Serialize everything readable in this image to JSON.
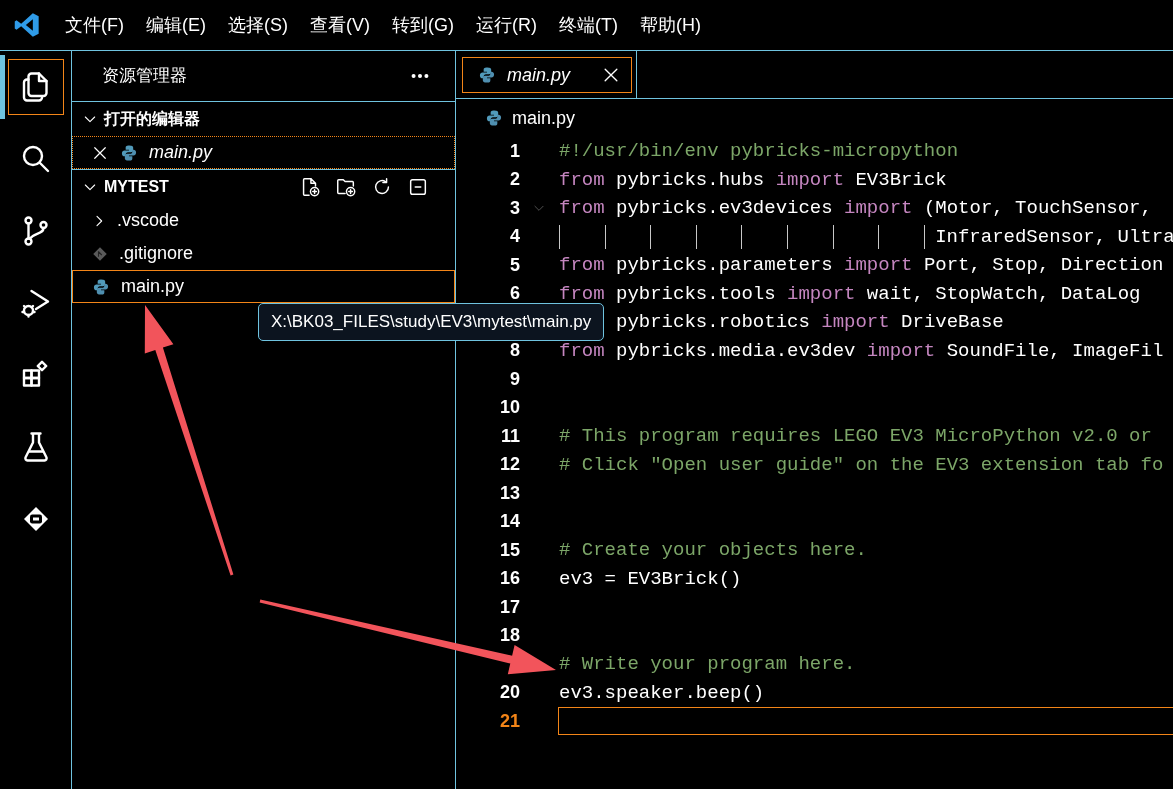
{
  "menu": [
    "文件(F)",
    "编辑(E)",
    "选择(S)",
    "查看(V)",
    "转到(G)",
    "运行(R)",
    "终端(T)",
    "帮助(H)"
  ],
  "activity_bar": [
    {
      "kind": "files",
      "selected": true
    },
    {
      "kind": "search",
      "selected": false
    },
    {
      "kind": "source-control",
      "selected": false
    },
    {
      "kind": "run-debug",
      "selected": false
    },
    {
      "kind": "extensions",
      "selected": false
    },
    {
      "kind": "testing",
      "selected": false
    },
    {
      "kind": "robot",
      "selected": false
    }
  ],
  "sidebar": {
    "title": "资源管理器",
    "open_editors": {
      "title": "打开的编辑器",
      "expanded": true,
      "items": [
        {
          "name": "main.py",
          "selected": true
        }
      ]
    },
    "folder": {
      "title": "MYTEST",
      "expanded": true,
      "items": [
        {
          "name": ".vscode",
          "kind": "folder",
          "expanded": false,
          "selected": false
        },
        {
          "name": ".gitignore",
          "kind": "git",
          "selected": false
        },
        {
          "name": "main.py",
          "kind": "python",
          "selected": true
        }
      ]
    },
    "tooltip": "X:\\BK03_FILES\\study\\EV3\\mytest\\main.py"
  },
  "tabs": [
    {
      "label": "main.py",
      "selected": true
    }
  ],
  "breadcrumb": [
    "main.py"
  ],
  "editor": {
    "lines": [
      {
        "number": "1",
        "current": false,
        "tokens": [
          {
            "kind": "comment",
            "text": "#!/usr/bin/env pybricks-micropython"
          }
        ]
      },
      {
        "number": "2",
        "current": false,
        "tokens": [
          {
            "kind": "keyword",
            "text": "from"
          },
          {
            "kind": "plain",
            "text": " pybricks.hubs "
          },
          {
            "kind": "keyword",
            "text": "import"
          },
          {
            "kind": "plain",
            "text": " EV3Brick"
          }
        ]
      },
      {
        "number": "3",
        "current": false,
        "foldable": true,
        "tokens": [
          {
            "kind": "keyword",
            "text": "from"
          },
          {
            "kind": "plain",
            "text": " pybricks.ev3devices "
          },
          {
            "kind": "keyword",
            "text": "import"
          },
          {
            "kind": "plain",
            "text": " (Motor, TouchSensor,"
          }
        ]
      },
      {
        "number": "4",
        "current": false,
        "tokens": [
          {
            "kind": "plain",
            "text": "                                 InfraredSensor, Ultra"
          }
        ]
      },
      {
        "number": "5",
        "current": false,
        "tokens": [
          {
            "kind": "keyword",
            "text": "from"
          },
          {
            "kind": "plain",
            "text": " pybricks.parameters "
          },
          {
            "kind": "keyword",
            "text": "import"
          },
          {
            "kind": "plain",
            "text": " Port, Stop, Direction"
          }
        ]
      },
      {
        "number": "6",
        "current": false,
        "tokens": [
          {
            "kind": "keyword",
            "text": "from"
          },
          {
            "kind": "plain",
            "text": " pybricks.tools "
          },
          {
            "kind": "keyword",
            "text": "import"
          },
          {
            "kind": "plain",
            "text": " wait, StopWatch, DataLog"
          }
        ]
      },
      {
        "current": false,
        "tokens": [
          {
            "kind": "plain",
            "text": "     pybricks.robotics "
          },
          {
            "kind": "keyword",
            "text": "import"
          },
          {
            "kind": "plain",
            "text": " DriveBase"
          }
        ]
      },
      {
        "number": "8",
        "current": false,
        "tokens": [
          {
            "kind": "keyword",
            "text": "from"
          },
          {
            "kind": "plain",
            "text": " pybricks.media.ev3dev "
          },
          {
            "kind": "keyword",
            "text": "import"
          },
          {
            "kind": "plain",
            "text": " SoundFile, ImageFil"
          }
        ]
      },
      {
        "number": "9",
        "current": false
      },
      {
        "number": "10",
        "current": false
      },
      {
        "number": "11",
        "current": false,
        "tokens": [
          {
            "kind": "comment",
            "text": "# This program requires LEGO EV3 MicroPython v2.0 or"
          }
        ]
      },
      {
        "number": "12",
        "current": false,
        "tokens": [
          {
            "kind": "comment",
            "text": "# Click \"Open user guide\" on the EV3 extension tab fo"
          }
        ]
      },
      {
        "number": "13",
        "current": false
      },
      {
        "number": "14",
        "current": false
      },
      {
        "number": "15",
        "current": false,
        "tokens": [
          {
            "kind": "comment",
            "text": "# Create your objects here."
          }
        ]
      },
      {
        "number": "16",
        "current": false,
        "tokens": [
          {
            "kind": "plain",
            "text": "ev3 = EV3Brick()"
          }
        ]
      },
      {
        "number": "17",
        "current": false
      },
      {
        "number": "18",
        "current": false
      },
      {
        "current": false,
        "tokens": [
          {
            "kind": "comment",
            "text": "# Write your program here."
          }
        ]
      },
      {
        "number": "20",
        "current": false,
        "tokens": [
          {
            "kind": "plain",
            "text": "ev3.speaker.beep()"
          }
        ]
      },
      {
        "number": "21",
        "current": true
      }
    ]
  },
  "annotation_arrows": [
    {
      "kind": "arrow"
    },
    {
      "kind": "arrow"
    }
  ]
}
